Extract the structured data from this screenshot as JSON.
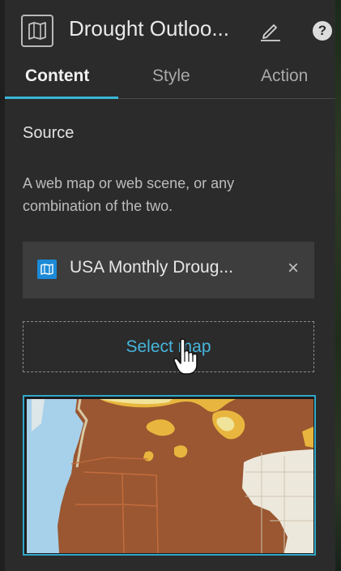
{
  "header": {
    "title": "Drought Outloo...",
    "card_icon": "map-icon",
    "edit_icon": "pencil-icon",
    "help_icon": "question-icon",
    "help_glyph": "?"
  },
  "tabs": [
    {
      "label": "Content",
      "active": true
    },
    {
      "label": "Style",
      "active": false
    },
    {
      "label": "Action",
      "active": false
    }
  ],
  "source": {
    "title": "Source",
    "description": "A web map or web scene, or any combination of the two."
  },
  "selected_map": {
    "label": "USA Monthly Droug...",
    "icon": "map-icon",
    "remove_glyph": "×"
  },
  "select_map_button": {
    "label": "Select map"
  },
  "thumbnail": {
    "description_icon": "map-thumbnail"
  },
  "colors": {
    "accent": "#3ab6d6",
    "panel": "#2b2b2b",
    "map_item_bg": "#3d3d3d",
    "map_icon_bg": "#1c8ad8",
    "drought_brown": "#9a5731",
    "drought_yellow": "#e8b63e"
  }
}
